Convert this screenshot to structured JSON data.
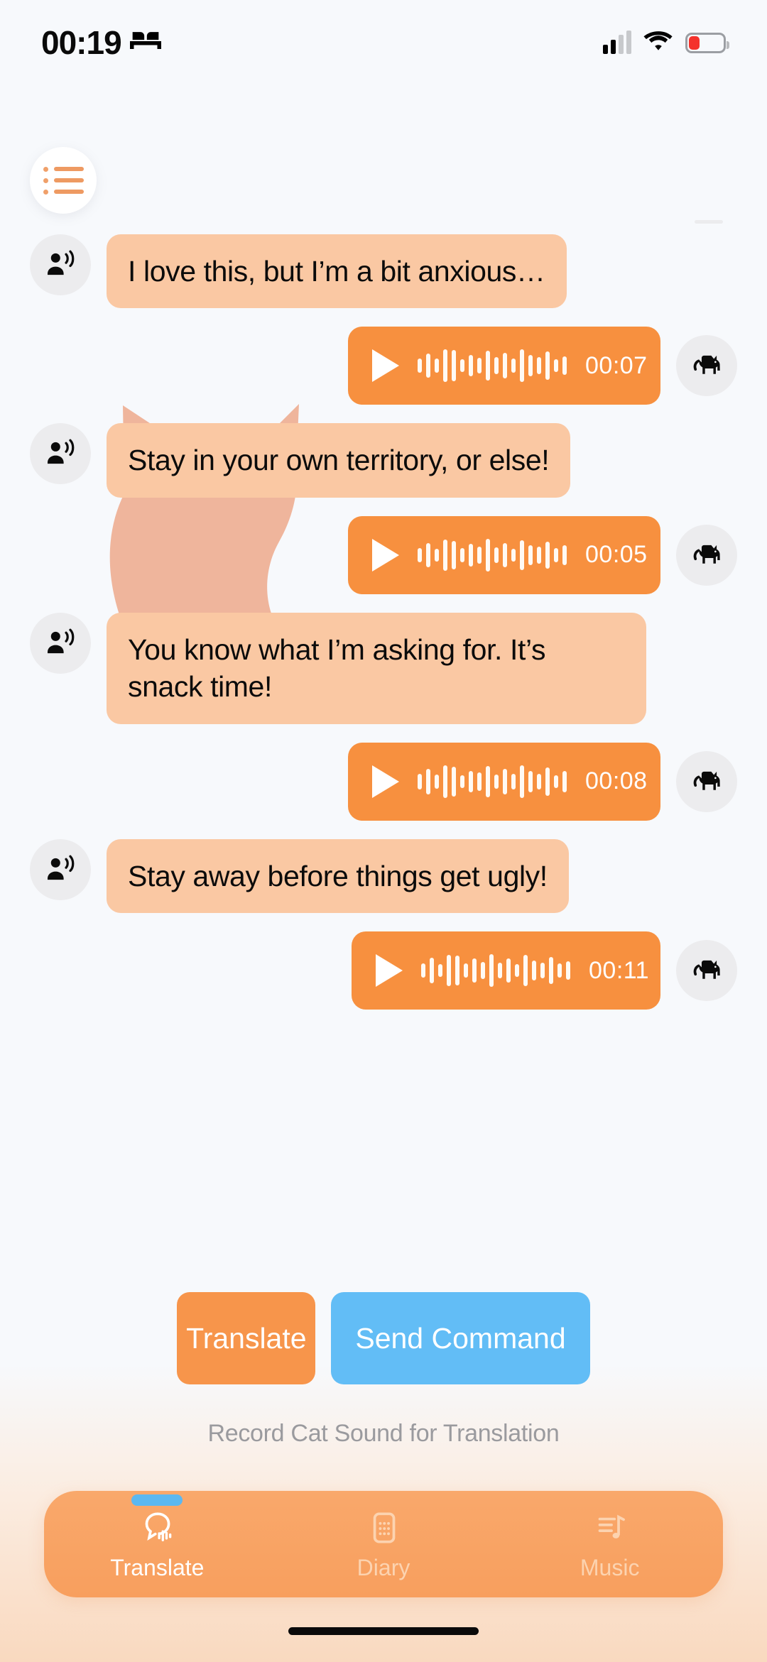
{
  "status_bar": {
    "time": "00:19",
    "sleep_icon": "bed-icon",
    "signal_icon": "cellular-signal-icon",
    "wifi_icon": "wifi-icon",
    "battery_icon": "battery-low-icon",
    "battery_level_percent": 32
  },
  "header": {
    "menu_button_label": "menu",
    "menu_icon": "list-bullets-icon"
  },
  "watermark": {
    "icon": "cat-silhouette-watermark",
    "color": "#ea7b4a"
  },
  "colors": {
    "accent_orange": "#f7903f",
    "bubble_peach": "#fac8a3",
    "blue": "#62bdf6",
    "background": "#f7f9fc",
    "avatar_gray": "#ececee"
  },
  "conversation": [
    {
      "type": "text",
      "side": "left",
      "avatar_icon": "person-speaking-icon",
      "text": "I love this, but I’m a bit anxious…"
    },
    {
      "type": "audio",
      "side": "right",
      "avatar_icon": "cat-icon",
      "play_icon": "play-icon",
      "waveform_icon": "audio-waveform-icon",
      "duration": "00:07"
    },
    {
      "type": "text",
      "side": "left",
      "avatar_icon": "person-speaking-icon",
      "text": "Stay in your own territory, or else!"
    },
    {
      "type": "audio",
      "side": "right",
      "avatar_icon": "cat-icon",
      "play_icon": "play-icon",
      "waveform_icon": "audio-waveform-icon",
      "duration": "00:05"
    },
    {
      "type": "text",
      "side": "left",
      "avatar_icon": "person-speaking-icon",
      "text": "You know what I’m asking for. It’s snack time!"
    },
    {
      "type": "audio",
      "side": "right",
      "avatar_icon": "cat-icon",
      "play_icon": "play-icon",
      "waveform_icon": "audio-waveform-icon",
      "duration": "00:08"
    },
    {
      "type": "text",
      "side": "left",
      "avatar_icon": "person-speaking-icon",
      "text": "Stay away before things get ugly!"
    },
    {
      "type": "audio",
      "side": "right",
      "avatar_icon": "cat-icon",
      "play_icon": "play-icon",
      "waveform_icon": "audio-waveform-icon",
      "duration": "00:11"
    }
  ],
  "actions": {
    "translate_label": "Translate",
    "send_command_label": "Send Command",
    "hint": "Record Cat Sound for Translation"
  },
  "tabbar": {
    "items": [
      {
        "label": "Translate",
        "icon": "speech-bubble-waveform-icon",
        "active": true
      },
      {
        "label": "Diary",
        "icon": "diary-grid-icon",
        "active": false
      },
      {
        "label": "Music",
        "icon": "music-note-icon",
        "active": false
      }
    ]
  }
}
